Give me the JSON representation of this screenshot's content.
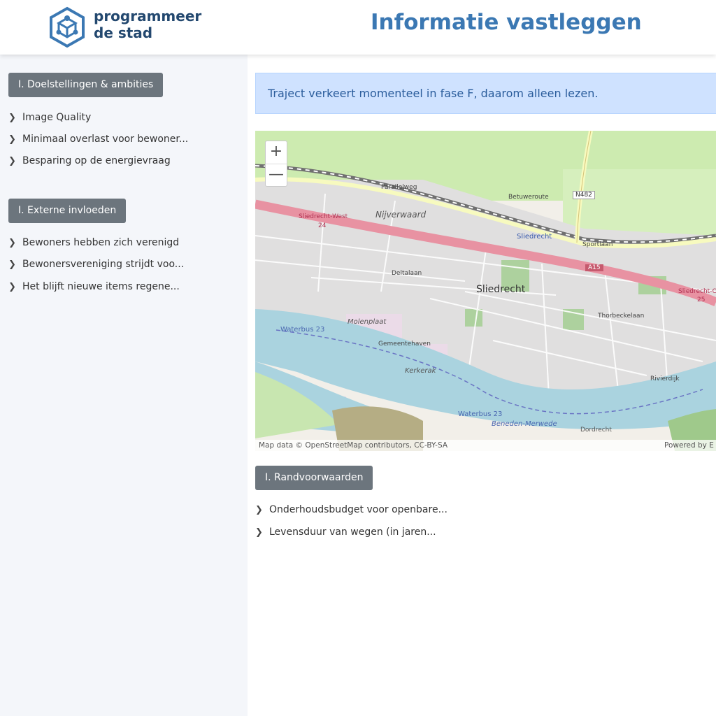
{
  "header": {
    "logo_line1": "programmeer",
    "logo_line2": "de stad",
    "title": "Informatie vastleggen"
  },
  "sidebar": {
    "sections": [
      {
        "label": "I. Doelstellingen & ambities",
        "items": [
          "Image Quality",
          "Minimaal overlast voor bewoner...",
          "Besparing op de energievraag"
        ]
      },
      {
        "label": "I. Externe invloeden",
        "items": [
          "Bewoners hebben zich verenigd",
          "Bewonersvereniging strijdt voo...",
          "Het blijft nieuwe items regene..."
        ]
      }
    ]
  },
  "main": {
    "alert": "Traject verkeert momenteel in fase F, daarom alleen lezen.",
    "map": {
      "zoom_in": "+",
      "zoom_out": "—",
      "attribution_left": "Map data © OpenStreetMap contributors, CC-BY-SA",
      "attribution_right": "Powered by E",
      "labels": {
        "city": "Sliedrecht",
        "district1": "Nijverwaard",
        "district2": "Molenplaat",
        "district3": "Kerkerak",
        "station1": "Sliedrecht-West",
        "station2": "Sliedrecht",
        "station3": "Sliedrecht-O",
        "road_parallelweg": "Parallelweg",
        "road_betuweroute": "Betuweroute",
        "road_sportlaan": "Sportlaan",
        "road_deltalaan": "Deltalaan",
        "road_thorbecke": "Thorbeckelaan",
        "road_rivierdijk": "Rivierdijk",
        "road_gemeentehaven": "Gemeentehaven",
        "n482": "N482",
        "a15": "A15",
        "n24": "24",
        "n25": "25",
        "waterbus1": "Waterbus 23",
        "waterbus2": "Waterbus 23",
        "river": "Beneden-Merwede",
        "dordrecht": "Dordrecht"
      }
    },
    "section": {
      "label": "I. Randvoorwaarden",
      "items": [
        "Onderhoudsbudget voor openbare...",
        "Levensduur van wegen (in jaren..."
      ]
    }
  },
  "colors": {
    "accent": "#3b78b3",
    "logo": "#23486f",
    "button": "#6c757d",
    "alert_bg": "#cfe2ff",
    "water": "#aad3df",
    "motorway": "#e892a2",
    "grass": "#cdebb0"
  }
}
